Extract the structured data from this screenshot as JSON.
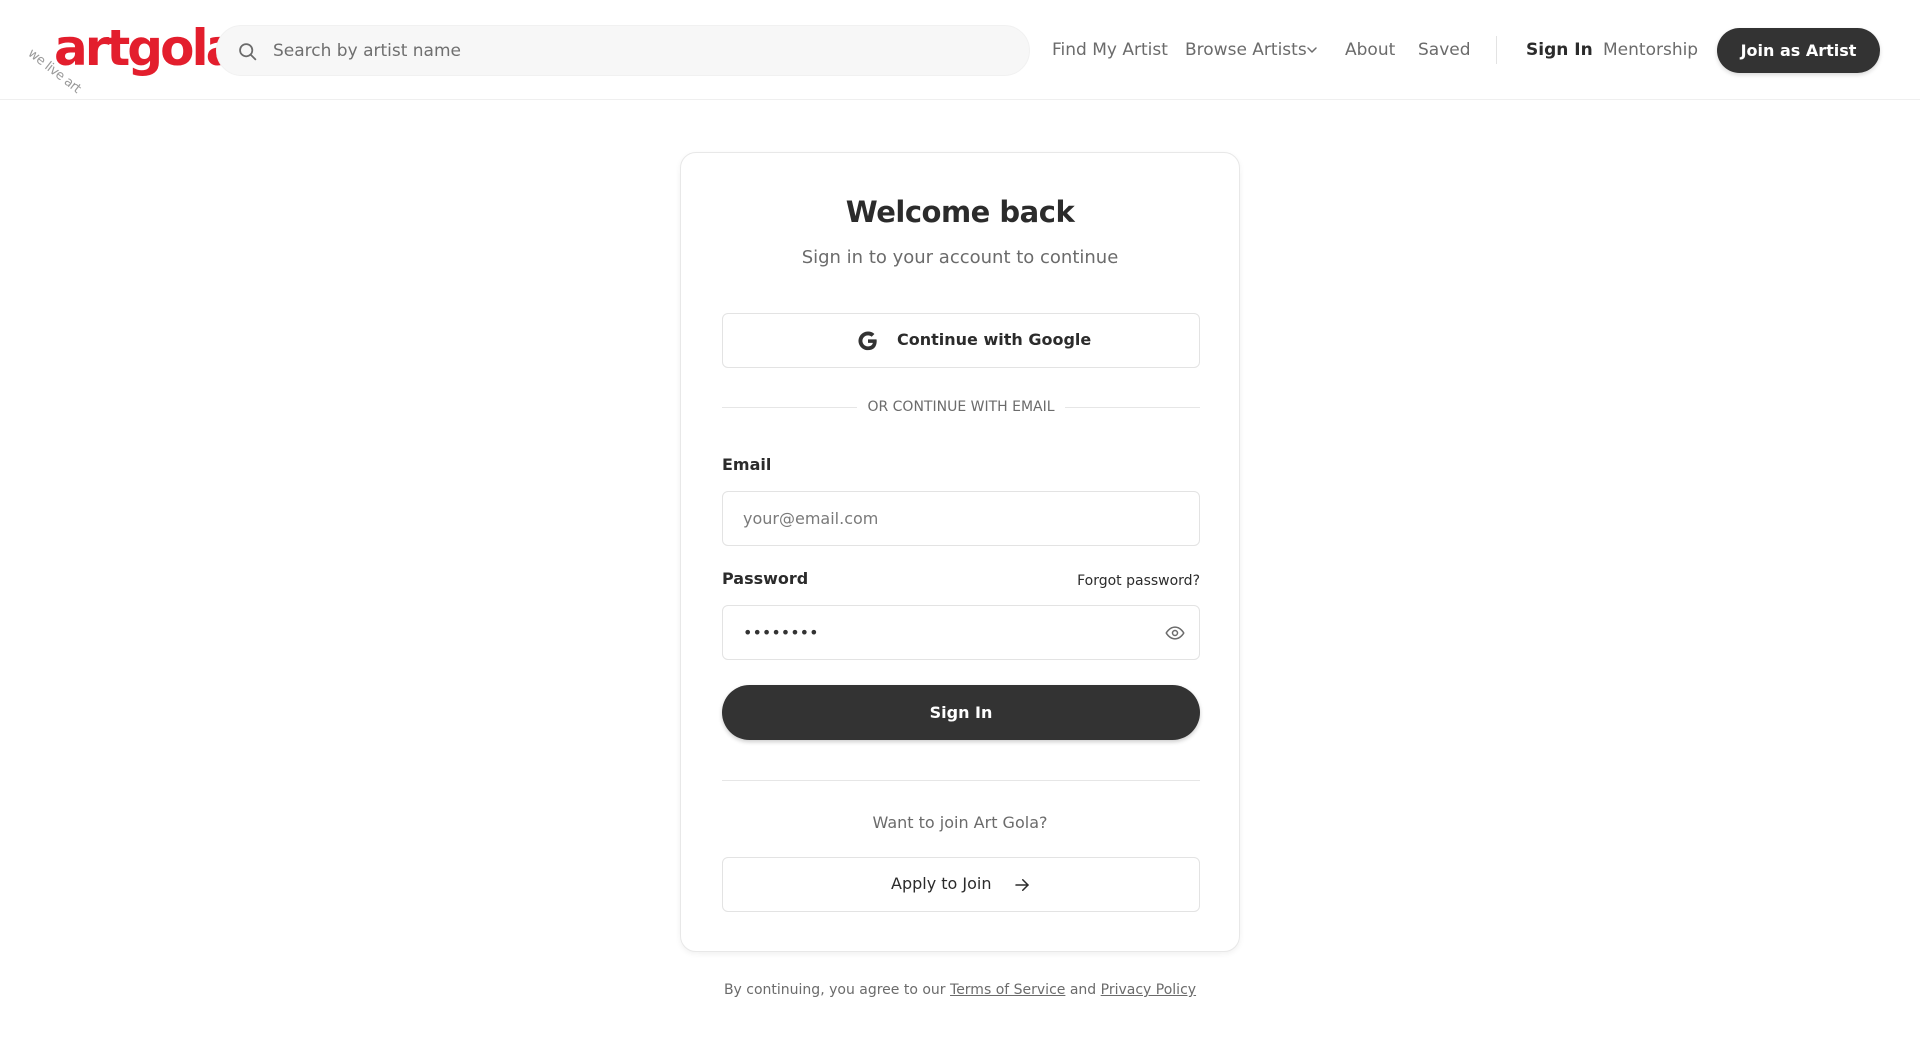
{
  "header": {
    "logo_text": "artgola",
    "logo_tagline": "we live art",
    "search_placeholder": "Search by artist name",
    "nav": {
      "find_my_artist": "Find My Artist",
      "browse_artists": "Browse Artists",
      "about": "About",
      "saved": "Saved",
      "sign_in": "Sign In",
      "mentorship": "Mentorship"
    },
    "join_button": "Join as Artist"
  },
  "login": {
    "title": "Welcome back",
    "subtitle": "Sign in to your account to continue",
    "google_button": "Continue with Google",
    "divider": "OR CONTINUE WITH EMAIL",
    "email_label": "Email",
    "email_placeholder": "your@email.com",
    "password_label": "Password",
    "password_value": "••••••••",
    "forgot_password": "Forgot password?",
    "sign_in_button": "Sign In",
    "join_prompt": "Want to join Art Gola?",
    "apply_button": "Apply to Join"
  },
  "footer": {
    "legal_prefix": "By continuing, you agree to our",
    "terms": "Terms of Service",
    "and": "and",
    "privacy": "Privacy Policy"
  },
  "colors": {
    "brand_red": "#e31e2d",
    "primary_dark": "#333333",
    "muted_text": "#6b6b6b"
  },
  "icons": [
    "search-icon",
    "chevron-down-icon",
    "google-icon",
    "eye-icon",
    "arrow-right-icon"
  ]
}
